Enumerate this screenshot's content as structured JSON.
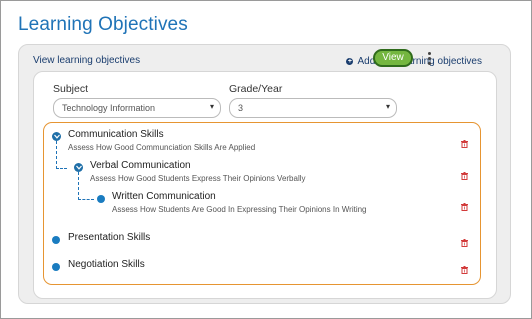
{
  "page": {
    "title": "Learning Objectives"
  },
  "panel": {
    "section_label": "View learning objectives",
    "add_link_label": "Add new learning objectives"
  },
  "filters": {
    "subject_label": "Subject",
    "subject_value": "Technology Information",
    "grade_label": "Grade/Year",
    "grade_value": "3",
    "view_button": "View"
  },
  "objectives": [
    {
      "title": "Communication Skills",
      "description": "Assess How Good Communciation Skills Are Applied",
      "level": 0,
      "expanded": true
    },
    {
      "title": "Verbal Communication",
      "description": "Assess How Good Students Express Their Opinions Verbally",
      "level": 1,
      "expanded": true
    },
    {
      "title": "Written Communication",
      "description": "Assess How Students Are Good In Expressing Their Opinions In Writing",
      "level": 2,
      "expanded": false
    },
    {
      "title": "Presentation Skills",
      "description": "",
      "level": 0,
      "expanded": false
    },
    {
      "title": "Negotiation Skills",
      "description": "",
      "level": 0,
      "expanded": false
    }
  ],
  "icons": {
    "add": "plus-circle-icon",
    "caret": "chevron-down-icon",
    "menu": "kebab-menu-icon",
    "expand": "chevron-down-circle-icon",
    "leaf": "dot-icon",
    "delete": "trash-icon"
  },
  "colors": {
    "title": "#1f73b7",
    "view_button": "#74b63f",
    "view_border": "#2f6b1b",
    "highlight_border": "#e69532",
    "delete_icon": "#d23a3a",
    "node": "#1a7cc0"
  }
}
